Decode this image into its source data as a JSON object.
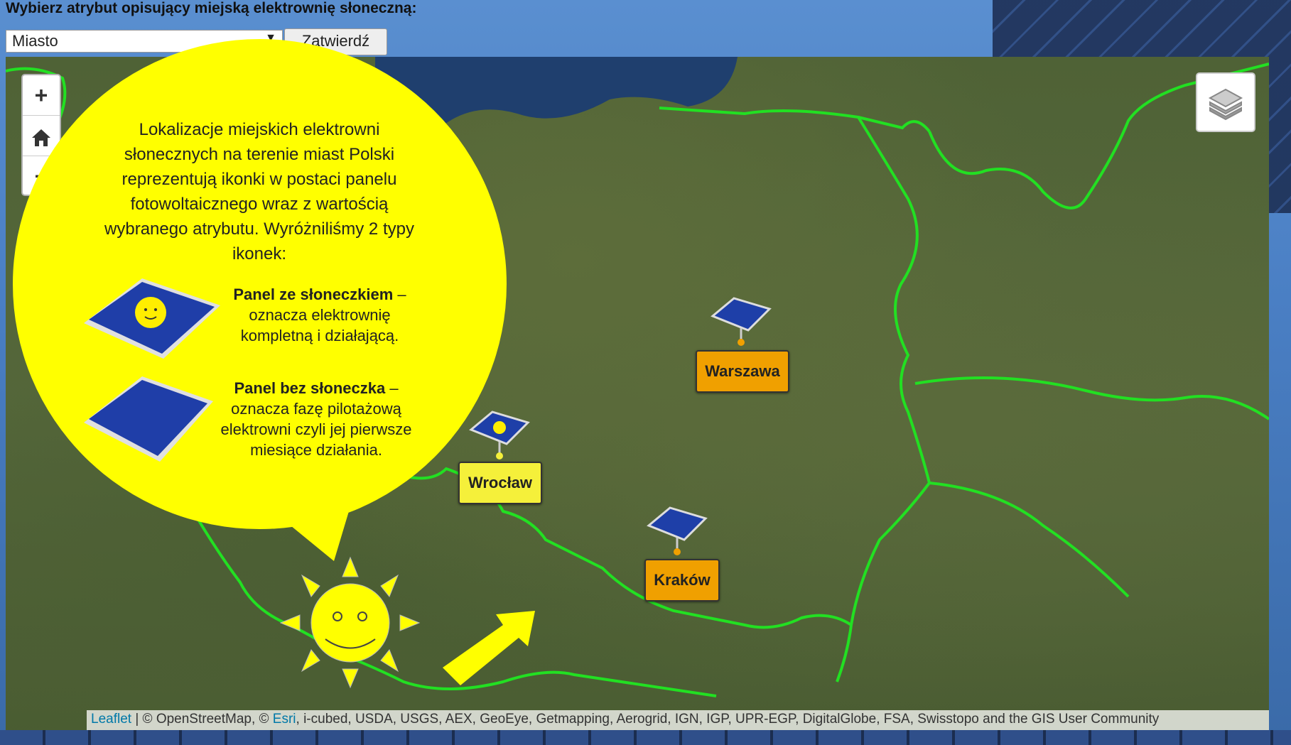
{
  "header": {
    "prompt": "Wybierz atrybut opisujący miejską elektrownię słoneczną:",
    "select_value": "Miasto",
    "submit_label": "Zatwierdź"
  },
  "map_controls": {
    "zoom_in": "+",
    "home_icon": "home-icon",
    "layers_icon": "layers-icon"
  },
  "bubble": {
    "intro": "Lokalizacje miejskich elektrowni słonecznych na terenie miast Polski reprezentują ikonki w postaci panelu fotowoltaicznego wraz z wartością wybranego atrybutu. Wyróżniliśmy 2 typy ikonek:",
    "legend": [
      {
        "title": "Panel ze słoneczkiem",
        "desc": " – oznacza elektrownię kompletną i działającą.",
        "icon": "panel-with-sun-icon"
      },
      {
        "title": "Panel bez słoneczka",
        "desc": " – oznacza fazę pilotażową elektrowni czyli jej pierwsze miesiące działania.",
        "icon": "panel-icon"
      }
    ]
  },
  "markers": [
    {
      "label": "Warszawa",
      "type": "panel",
      "color": "#f0a000"
    },
    {
      "label": "Wrocław",
      "type": "panel-with-sun",
      "color": "#f5f03a"
    },
    {
      "label": "Kraków",
      "type": "panel",
      "color": "#f0a000"
    }
  ],
  "attribution": {
    "leaflet": "Leaflet",
    "sep1": " | © OpenStreetMap, © ",
    "esri": "Esri",
    "rest": ", i-cubed, USDA, USGS, AEX, GeoEye, Getmapping, Aerogrid, IGN, IGP, UPR-EGP, DigitalGlobe, FSA, Swisstopo and the GIS User Community"
  },
  "colors": {
    "border_lines": "#22e022",
    "bubble": "#ffff00",
    "sea": "#1f3f6e"
  }
}
